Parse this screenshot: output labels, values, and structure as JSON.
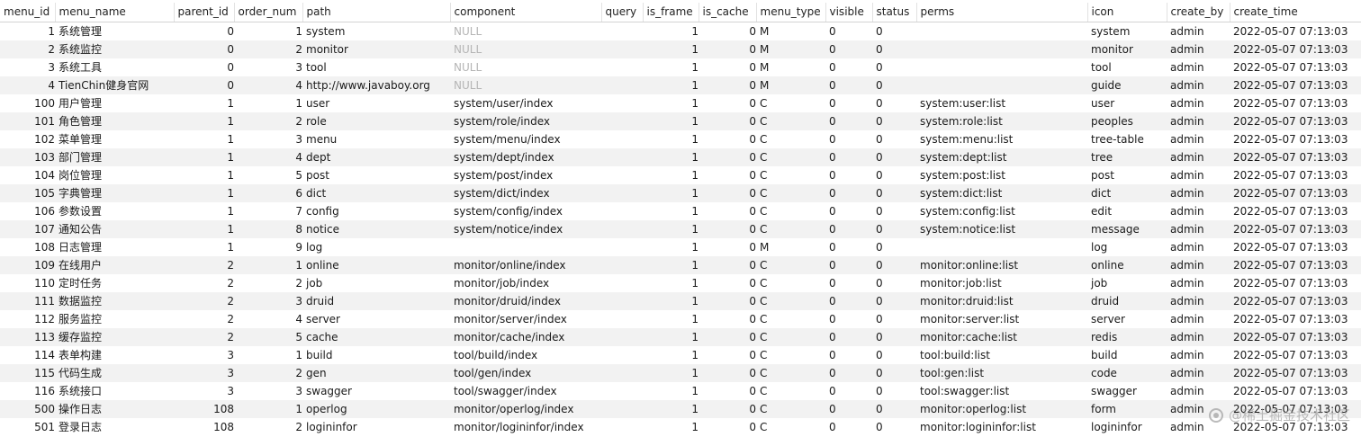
{
  "columns": [
    "menu_id",
    "menu_name",
    "parent_id",
    "order_num",
    "path",
    "component",
    "query",
    "is_frame",
    "is_cache",
    "menu_type",
    "visible",
    "status",
    "perms",
    "icon",
    "create_by",
    "create_time"
  ],
  "rows": [
    {
      "menu_id": "1",
      "menu_name": "系统管理",
      "parent_id": "0",
      "order_num": "1",
      "path": "system",
      "component": "NULL",
      "query": "",
      "is_frame": "1",
      "is_cache": "0",
      "menu_type": "M",
      "visible": "0",
      "status": "0",
      "perms": "",
      "icon": "system",
      "create_by": "admin",
      "create_time": "2022-05-07 07:13:03"
    },
    {
      "menu_id": "2",
      "menu_name": "系统监控",
      "parent_id": "0",
      "order_num": "2",
      "path": "monitor",
      "component": "NULL",
      "query": "",
      "is_frame": "1",
      "is_cache": "0",
      "menu_type": "M",
      "visible": "0",
      "status": "0",
      "perms": "",
      "icon": "monitor",
      "create_by": "admin",
      "create_time": "2022-05-07 07:13:03"
    },
    {
      "menu_id": "3",
      "menu_name": "系统工具",
      "parent_id": "0",
      "order_num": "3",
      "path": "tool",
      "component": "NULL",
      "query": "",
      "is_frame": "1",
      "is_cache": "0",
      "menu_type": "M",
      "visible": "0",
      "status": "0",
      "perms": "",
      "icon": "tool",
      "create_by": "admin",
      "create_time": "2022-05-07 07:13:03"
    },
    {
      "menu_id": "4",
      "menu_name": "TienChin健身官网",
      "parent_id": "0",
      "order_num": "4",
      "path": "http://www.javaboy.org",
      "component": "NULL",
      "query": "",
      "is_frame": "1",
      "is_cache": "0",
      "menu_type": "M",
      "visible": "0",
      "status": "0",
      "perms": "",
      "icon": "guide",
      "create_by": "admin",
      "create_time": "2022-05-07 07:13:03"
    },
    {
      "menu_id": "100",
      "menu_name": "用户管理",
      "parent_id": "1",
      "order_num": "1",
      "path": "user",
      "component": "system/user/index",
      "query": "",
      "is_frame": "1",
      "is_cache": "0",
      "menu_type": "C",
      "visible": "0",
      "status": "0",
      "perms": "system:user:list",
      "icon": "user",
      "create_by": "admin",
      "create_time": "2022-05-07 07:13:03"
    },
    {
      "menu_id": "101",
      "menu_name": "角色管理",
      "parent_id": "1",
      "order_num": "2",
      "path": "role",
      "component": "system/role/index",
      "query": "",
      "is_frame": "1",
      "is_cache": "0",
      "menu_type": "C",
      "visible": "0",
      "status": "0",
      "perms": "system:role:list",
      "icon": "peoples",
      "create_by": "admin",
      "create_time": "2022-05-07 07:13:03"
    },
    {
      "menu_id": "102",
      "menu_name": "菜单管理",
      "parent_id": "1",
      "order_num": "3",
      "path": "menu",
      "component": "system/menu/index",
      "query": "",
      "is_frame": "1",
      "is_cache": "0",
      "menu_type": "C",
      "visible": "0",
      "status": "0",
      "perms": "system:menu:list",
      "icon": "tree-table",
      "create_by": "admin",
      "create_time": "2022-05-07 07:13:03"
    },
    {
      "menu_id": "103",
      "menu_name": "部门管理",
      "parent_id": "1",
      "order_num": "4",
      "path": "dept",
      "component": "system/dept/index",
      "query": "",
      "is_frame": "1",
      "is_cache": "0",
      "menu_type": "C",
      "visible": "0",
      "status": "0",
      "perms": "system:dept:list",
      "icon": "tree",
      "create_by": "admin",
      "create_time": "2022-05-07 07:13:03"
    },
    {
      "menu_id": "104",
      "menu_name": "岗位管理",
      "parent_id": "1",
      "order_num": "5",
      "path": "post",
      "component": "system/post/index",
      "query": "",
      "is_frame": "1",
      "is_cache": "0",
      "menu_type": "C",
      "visible": "0",
      "status": "0",
      "perms": "system:post:list",
      "icon": "post",
      "create_by": "admin",
      "create_time": "2022-05-07 07:13:03"
    },
    {
      "menu_id": "105",
      "menu_name": "字典管理",
      "parent_id": "1",
      "order_num": "6",
      "path": "dict",
      "component": "system/dict/index",
      "query": "",
      "is_frame": "1",
      "is_cache": "0",
      "menu_type": "C",
      "visible": "0",
      "status": "0",
      "perms": "system:dict:list",
      "icon": "dict",
      "create_by": "admin",
      "create_time": "2022-05-07 07:13:03"
    },
    {
      "menu_id": "106",
      "menu_name": "参数设置",
      "parent_id": "1",
      "order_num": "7",
      "path": "config",
      "component": "system/config/index",
      "query": "",
      "is_frame": "1",
      "is_cache": "0",
      "menu_type": "C",
      "visible": "0",
      "status": "0",
      "perms": "system:config:list",
      "icon": "edit",
      "create_by": "admin",
      "create_time": "2022-05-07 07:13:03"
    },
    {
      "menu_id": "107",
      "menu_name": "通知公告",
      "parent_id": "1",
      "order_num": "8",
      "path": "notice",
      "component": "system/notice/index",
      "query": "",
      "is_frame": "1",
      "is_cache": "0",
      "menu_type": "C",
      "visible": "0",
      "status": "0",
      "perms": "system:notice:list",
      "icon": "message",
      "create_by": "admin",
      "create_time": "2022-05-07 07:13:03"
    },
    {
      "menu_id": "108",
      "menu_name": "日志管理",
      "parent_id": "1",
      "order_num": "9",
      "path": "log",
      "component": "",
      "query": "",
      "is_frame": "1",
      "is_cache": "0",
      "menu_type": "M",
      "visible": "0",
      "status": "0",
      "perms": "",
      "icon": "log",
      "create_by": "admin",
      "create_time": "2022-05-07 07:13:03"
    },
    {
      "menu_id": "109",
      "menu_name": "在线用户",
      "parent_id": "2",
      "order_num": "1",
      "path": "online",
      "component": "monitor/online/index",
      "query": "",
      "is_frame": "1",
      "is_cache": "0",
      "menu_type": "C",
      "visible": "0",
      "status": "0",
      "perms": "monitor:online:list",
      "icon": "online",
      "create_by": "admin",
      "create_time": "2022-05-07 07:13:03"
    },
    {
      "menu_id": "110",
      "menu_name": "定时任务",
      "parent_id": "2",
      "order_num": "2",
      "path": "job",
      "component": "monitor/job/index",
      "query": "",
      "is_frame": "1",
      "is_cache": "0",
      "menu_type": "C",
      "visible": "0",
      "status": "0",
      "perms": "monitor:job:list",
      "icon": "job",
      "create_by": "admin",
      "create_time": "2022-05-07 07:13:03"
    },
    {
      "menu_id": "111",
      "menu_name": "数据监控",
      "parent_id": "2",
      "order_num": "3",
      "path": "druid",
      "component": "monitor/druid/index",
      "query": "",
      "is_frame": "1",
      "is_cache": "0",
      "menu_type": "C",
      "visible": "0",
      "status": "0",
      "perms": "monitor:druid:list",
      "icon": "druid",
      "create_by": "admin",
      "create_time": "2022-05-07 07:13:03"
    },
    {
      "menu_id": "112",
      "menu_name": "服务监控",
      "parent_id": "2",
      "order_num": "4",
      "path": "server",
      "component": "monitor/server/index",
      "query": "",
      "is_frame": "1",
      "is_cache": "0",
      "menu_type": "C",
      "visible": "0",
      "status": "0",
      "perms": "monitor:server:list",
      "icon": "server",
      "create_by": "admin",
      "create_time": "2022-05-07 07:13:03"
    },
    {
      "menu_id": "113",
      "menu_name": "缓存监控",
      "parent_id": "2",
      "order_num": "5",
      "path": "cache",
      "component": "monitor/cache/index",
      "query": "",
      "is_frame": "1",
      "is_cache": "0",
      "menu_type": "C",
      "visible": "0",
      "status": "0",
      "perms": "monitor:cache:list",
      "icon": "redis",
      "create_by": "admin",
      "create_time": "2022-05-07 07:13:03"
    },
    {
      "menu_id": "114",
      "menu_name": "表单构建",
      "parent_id": "3",
      "order_num": "1",
      "path": "build",
      "component": "tool/build/index",
      "query": "",
      "is_frame": "1",
      "is_cache": "0",
      "menu_type": "C",
      "visible": "0",
      "status": "0",
      "perms": "tool:build:list",
      "icon": "build",
      "create_by": "admin",
      "create_time": "2022-05-07 07:13:03"
    },
    {
      "menu_id": "115",
      "menu_name": "代码生成",
      "parent_id": "3",
      "order_num": "2",
      "path": "gen",
      "component": "tool/gen/index",
      "query": "",
      "is_frame": "1",
      "is_cache": "0",
      "menu_type": "C",
      "visible": "0",
      "status": "0",
      "perms": "tool:gen:list",
      "icon": "code",
      "create_by": "admin",
      "create_time": "2022-05-07 07:13:03"
    },
    {
      "menu_id": "116",
      "menu_name": "系统接口",
      "parent_id": "3",
      "order_num": "3",
      "path": "swagger",
      "component": "tool/swagger/index",
      "query": "",
      "is_frame": "1",
      "is_cache": "0",
      "menu_type": "C",
      "visible": "0",
      "status": "0",
      "perms": "tool:swagger:list",
      "icon": "swagger",
      "create_by": "admin",
      "create_time": "2022-05-07 07:13:03"
    },
    {
      "menu_id": "500",
      "menu_name": "操作日志",
      "parent_id": "108",
      "order_num": "1",
      "path": "operlog",
      "component": "monitor/operlog/index",
      "query": "",
      "is_frame": "1",
      "is_cache": "0",
      "menu_type": "C",
      "visible": "0",
      "status": "0",
      "perms": "monitor:operlog:list",
      "icon": "form",
      "create_by": "admin",
      "create_time": "2022-05-07 07:13:03"
    },
    {
      "menu_id": "501",
      "menu_name": "登录日志",
      "parent_id": "108",
      "order_num": "2",
      "path": "logininfor",
      "component": "monitor/logininfor/index",
      "query": "",
      "is_frame": "1",
      "is_cache": "0",
      "menu_type": "C",
      "visible": "0",
      "status": "0",
      "perms": "monitor:logininfor:list",
      "icon": "logininfor",
      "create_by": "admin",
      "create_time": "2022-05-07 07:13:03"
    }
  ],
  "watermark": {
    "text": "@稀土掘金技术社区"
  }
}
